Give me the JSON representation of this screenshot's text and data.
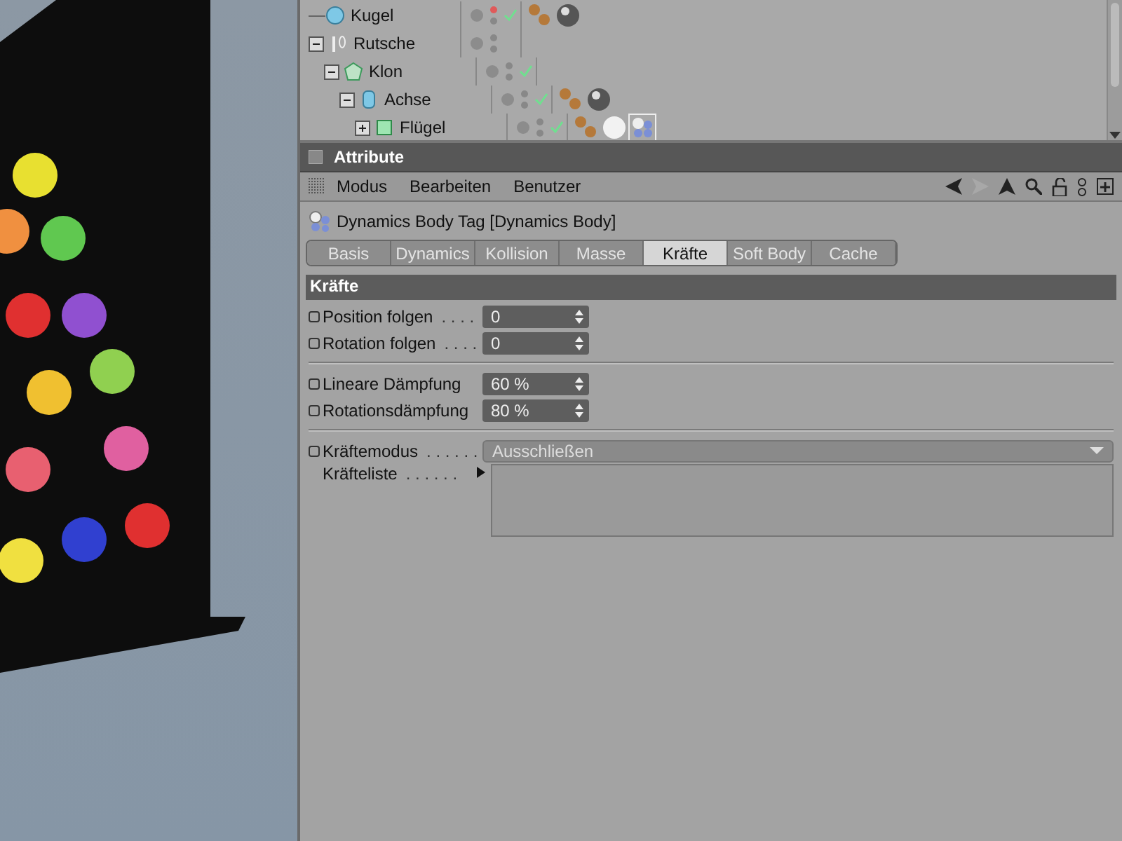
{
  "objects": [
    {
      "name": "Kugel",
      "kind": "sphere",
      "editor_off": true,
      "check": true,
      "tags": [
        {
          "kind": "material-dots",
          "selected": false
        },
        {
          "kind": "metal-sphere",
          "selected": false
        }
      ]
    },
    {
      "name": "Rutsche",
      "kind": "null",
      "expanded": true,
      "editor_off": false,
      "check": false,
      "children": [
        {
          "name": "Klon",
          "kind": "cloner",
          "expanded": true,
          "editor_off": false,
          "check": true,
          "children": [
            {
              "name": "Achse",
              "kind": "cylinder",
              "expanded": true,
              "editor_off": false,
              "check": true,
              "tags": [
                {
                  "kind": "material-dots",
                  "selected": false
                },
                {
                  "kind": "metal-sphere",
                  "selected": false
                }
              ],
              "children": [
                {
                  "name": "Flügel",
                  "kind": "cube",
                  "expanded": false,
                  "editor_off": false,
                  "check": true,
                  "tags": [
                    {
                      "kind": "material-dots",
                      "selected": false
                    },
                    {
                      "kind": "white-sphere",
                      "selected": false
                    },
                    {
                      "kind": "dynamics-tag",
                      "selected": true
                    }
                  ]
                }
              ]
            }
          ]
        }
      ]
    }
  ],
  "attributes": {
    "title": "Attribute",
    "menu": [
      "Modus",
      "Bearbeiten",
      "Benutzer"
    ],
    "object_title": "Dynamics Body Tag [Dynamics Body]",
    "tabs": [
      {
        "label": "Basis",
        "selected": false
      },
      {
        "label": "Dynamics",
        "selected": false
      },
      {
        "label": "Kollision",
        "selected": false
      },
      {
        "label": "Masse",
        "selected": false
      },
      {
        "label": "Kräfte",
        "selected": true
      },
      {
        "label": "Soft Body",
        "selected": false
      },
      {
        "label": "Cache",
        "selected": false
      }
    ],
    "section": "Kräfte",
    "groups": [
      [
        {
          "kind": "number",
          "label": "Position folgen",
          "dots": ". . . .",
          "value": "0"
        },
        {
          "kind": "number",
          "label": "Rotation folgen",
          "dots": ". . . .",
          "value": "0"
        }
      ],
      [
        {
          "kind": "number",
          "label": "Lineare Dämpfung",
          "value": "60 %"
        },
        {
          "kind": "number",
          "label": "Rotationsdämpfung",
          "value": "80 %"
        }
      ],
      [
        {
          "kind": "dropdown",
          "label": "Kräftemodus",
          "dots": ". . . . . .",
          "value": "Ausschließen"
        },
        {
          "kind": "list",
          "label": "Kräfteliste",
          "dots": ". . . . . ."
        }
      ]
    ]
  }
}
